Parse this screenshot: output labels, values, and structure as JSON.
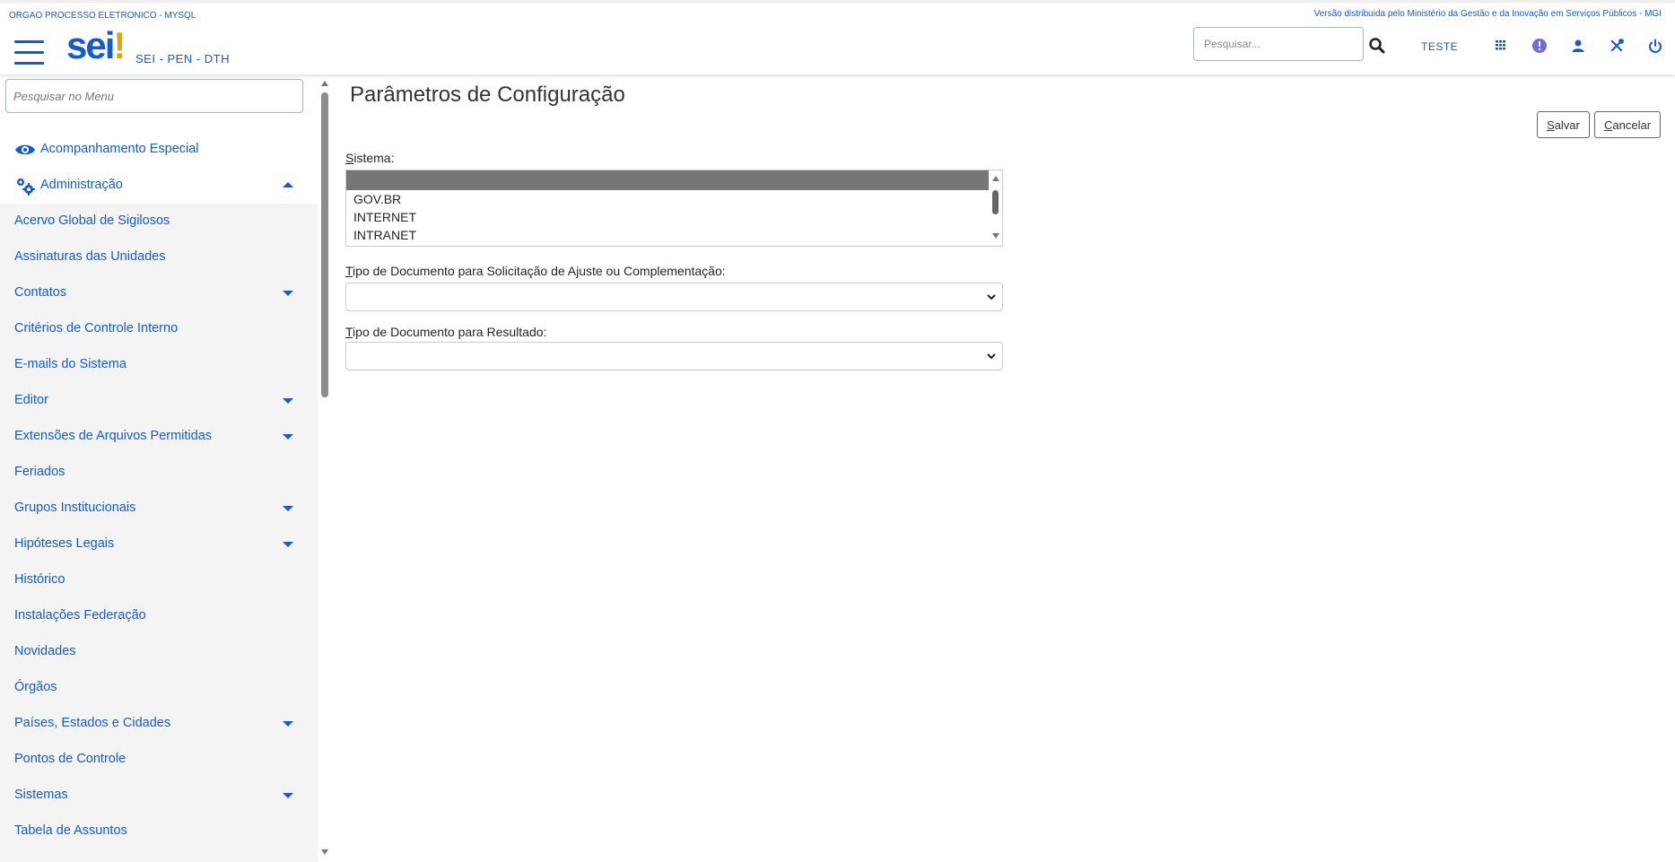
{
  "header": {
    "org_name": "ORGAO PROCESSO ELETRONICO - MYSQL",
    "version_text": "Versão distribuida pelo Ministério da Gestão e da Inovação em Serviços Públicos - MGI",
    "logo_text": "sei",
    "logo_mark": "!",
    "subtitle": "SEI - PEN - DTH",
    "search_placeholder": "Pesquisar...",
    "unit_label": "TESTE",
    "icons": [
      "menu-icon",
      "search-icon",
      "grid-icon",
      "alert-icon",
      "user-icon",
      "tools-icon",
      "power-icon"
    ]
  },
  "sidebar": {
    "search_placeholder": "Pesquisar no Menu",
    "top_items": [
      {
        "label": "Acompanhamento Especial",
        "icon": "eye-icon"
      },
      {
        "label": "Administração",
        "icon": "gears-icon",
        "expanded": true
      }
    ],
    "admin_items": [
      {
        "label": "Acervo Global de Sigilosos",
        "submenu": false
      },
      {
        "label": "Assinaturas das Unidades",
        "submenu": false
      },
      {
        "label": "Contatos",
        "submenu": true
      },
      {
        "label": "Critérios de Controle Interno",
        "submenu": false
      },
      {
        "label": "E-mails do Sistema",
        "submenu": false
      },
      {
        "label": "Editor",
        "submenu": true
      },
      {
        "label": "Extensões de Arquivos Permitidas",
        "submenu": true
      },
      {
        "label": "Feriados",
        "submenu": false
      },
      {
        "label": "Grupos Institucionais",
        "submenu": true
      },
      {
        "label": "Hipóteses Legais",
        "submenu": true
      },
      {
        "label": "Histórico",
        "submenu": false
      },
      {
        "label": "Instalações Federação",
        "submenu": false
      },
      {
        "label": "Novidades",
        "submenu": false
      },
      {
        "label": "Órgãos",
        "submenu": false
      },
      {
        "label": "Países, Estados e Cidades",
        "submenu": true
      },
      {
        "label": "Pontos de Controle",
        "submenu": false
      },
      {
        "label": "Sistemas",
        "submenu": true
      },
      {
        "label": "Tabela de Assuntos",
        "submenu": false
      }
    ]
  },
  "main": {
    "title": "Parâmetros de Configuração",
    "save": {
      "key": "S",
      "rest": "alvar"
    },
    "cancel": {
      "key": "C",
      "rest": "ancelar"
    },
    "sistema": {
      "label_key": "S",
      "label_rest": "istema:",
      "options": [
        "",
        "GOV.BR",
        "INTERNET",
        "INTRANET"
      ],
      "selected_index": 0
    },
    "tipo_ajuste": {
      "label_key": "T",
      "label_rest": "ipo de Documento para Solicitação de Ajuste ou Complementação:",
      "value": ""
    },
    "tipo_resultado": {
      "label_key": "T",
      "label_rest": "ipo de Documento para Resultado:",
      "value": ""
    }
  },
  "colors": {
    "brand_blue": "#155bcb",
    "logo_accent": "#e2a40b",
    "sidebar_bg": "#f4f4f4",
    "selected_option": "#767676"
  }
}
